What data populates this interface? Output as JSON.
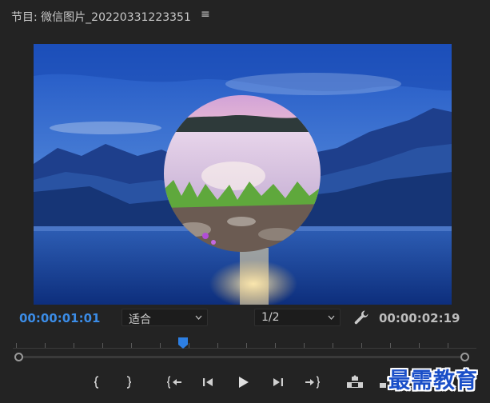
{
  "panel": {
    "title": "节目: 微信图片_20220331223351",
    "menu_glyph": "≡"
  },
  "viewer": {
    "timecode_current": "00:00:01:01",
    "timecode_duration": "00:00:02:19",
    "fit": {
      "selected": "适合"
    },
    "resolution": {
      "selected": "1/2"
    }
  },
  "timeline": {
    "playhead_fraction": 0.367
  },
  "controls": {
    "buttons": [
      {
        "name": "mark-in-button",
        "icon": "mark-in-icon"
      },
      {
        "name": "mark-out-button",
        "icon": "mark-out-icon"
      },
      {
        "name": "go-to-in-button",
        "icon": "go-to-in-icon"
      },
      {
        "name": "step-back-button",
        "icon": "step-back-icon"
      },
      {
        "name": "play-button",
        "icon": "play-icon"
      },
      {
        "name": "step-forward-button",
        "icon": "step-forward-icon"
      },
      {
        "name": "go-to-out-button",
        "icon": "go-to-out-icon"
      },
      {
        "name": "lift-button",
        "icon": "lift-icon"
      },
      {
        "name": "extract-button",
        "icon": "extract-icon"
      }
    ]
  },
  "watermark": {
    "text": "最需教育"
  },
  "colors": {
    "background": "#232323",
    "accent_timecode": "#3b8ce6",
    "playhead": "#2d7fe3",
    "watermark": "#1a4fc8"
  }
}
